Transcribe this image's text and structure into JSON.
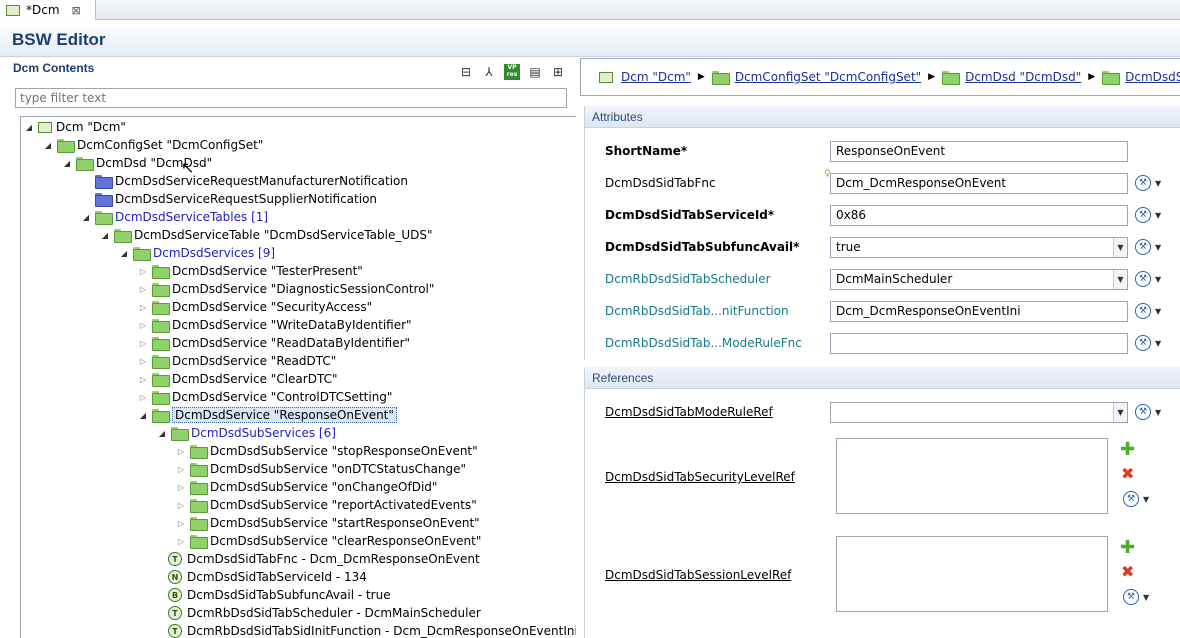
{
  "tab": {
    "title": "*Dcm"
  },
  "editor": {
    "title": "BSW Editor"
  },
  "left": {
    "title": "Dcm Contents",
    "filter_placeholder": "type filter text"
  },
  "tree": [
    {
      "label": "Dcm \"Dcm\"",
      "indent": 0,
      "twisty": "open",
      "icon": "dcm"
    },
    {
      "label": "DcmConfigSet \"DcmConfigSet\"",
      "indent": 1,
      "twisty": "open",
      "icon": "green"
    },
    {
      "label": "DcmDsd \"DcmDsd\"",
      "indent": 2,
      "twisty": "open",
      "icon": "green"
    },
    {
      "label": "DcmDsdServiceRequestManufacturerNotification",
      "indent": 3,
      "twisty": "none",
      "icon": "blue"
    },
    {
      "label": "DcmDsdServiceRequestSupplierNotification",
      "indent": 3,
      "twisty": "none",
      "icon": "blue"
    },
    {
      "label": "DcmDsdServiceTables [1]",
      "indent": 3,
      "twisty": "open",
      "icon": "green",
      "style": "blue"
    },
    {
      "label": "DcmDsdServiceTable \"DcmDsdServiceTable_UDS\"",
      "indent": 4,
      "twisty": "open",
      "icon": "green"
    },
    {
      "label": "DcmDsdServices [9]",
      "indent": 5,
      "twisty": "open",
      "icon": "green",
      "style": "blue"
    },
    {
      "label": "DcmDsdService \"TesterPresent\"",
      "indent": 6,
      "twisty": "closed",
      "icon": "green"
    },
    {
      "label": "DcmDsdService \"DiagnosticSessionControl\"",
      "indent": 6,
      "twisty": "closed",
      "icon": "green"
    },
    {
      "label": "DcmDsdService \"SecurityAccess\"",
      "indent": 6,
      "twisty": "closed",
      "icon": "green"
    },
    {
      "label": "DcmDsdService \"WriteDataByIdentifier\"",
      "indent": 6,
      "twisty": "closed",
      "icon": "green"
    },
    {
      "label": "DcmDsdService \"ReadDataByIdentifier\"",
      "indent": 6,
      "twisty": "closed",
      "icon": "green"
    },
    {
      "label": "DcmDsdService \"ReadDTC\"",
      "indent": 6,
      "twisty": "closed",
      "icon": "green"
    },
    {
      "label": "DcmDsdService \"ClearDTC\"",
      "indent": 6,
      "twisty": "closed",
      "icon": "green"
    },
    {
      "label": "DcmDsdService \"ControlDTCSetting\"",
      "indent": 6,
      "twisty": "closed",
      "icon": "green"
    },
    {
      "label": "DcmDsdService \"ResponseOnEvent\"",
      "indent": 6,
      "twisty": "open",
      "icon": "green",
      "style": "sel"
    },
    {
      "label": "DcmDsdSubServices [6]",
      "indent": 7,
      "twisty": "open",
      "icon": "green",
      "style": "blue"
    },
    {
      "label": "DcmDsdSubService \"stopResponseOnEvent\"",
      "indent": 8,
      "twisty": "closed",
      "icon": "green"
    },
    {
      "label": "DcmDsdSubService \"onDTCStatusChange\"",
      "indent": 8,
      "twisty": "closed",
      "icon": "green"
    },
    {
      "label": "DcmDsdSubService \"onChangeOfDid\"",
      "indent": 8,
      "twisty": "closed",
      "icon": "green"
    },
    {
      "label": "DcmDsdSubService \"reportActivatedEvents\"",
      "indent": 8,
      "twisty": "closed",
      "icon": "green"
    },
    {
      "label": "DcmDsdSubService \"startResponseOnEvent\"",
      "indent": 8,
      "twisty": "closed",
      "icon": "green"
    },
    {
      "label": "DcmDsdSubService \"clearResponseOnEvent\"",
      "indent": 8,
      "twisty": "closed",
      "icon": "green"
    },
    {
      "label": "DcmDsdSidTabFnc - Dcm_DcmResponseOnEvent",
      "indent": 7,
      "twisty": "none",
      "icon": "T"
    },
    {
      "label": "DcmDsdSidTabServiceId - 134",
      "indent": 7,
      "twisty": "none",
      "icon": "N"
    },
    {
      "label": "DcmDsdSidTabSubfuncAvail - true",
      "indent": 7,
      "twisty": "none",
      "icon": "B"
    },
    {
      "label": "DcmRbDsdSidTabScheduler - DcmMainScheduler",
      "indent": 7,
      "twisty": "none",
      "icon": "T"
    },
    {
      "label": "DcmRbDsdSidTabSidInitFunction - Dcm_DcmResponseOnEventIni",
      "indent": 7,
      "twisty": "none",
      "icon": "T"
    }
  ],
  "breadcrumb": [
    "Dcm \"Dcm\"",
    "DcmConfigSet \"DcmConfigSet\"",
    "DcmDsd \"DcmDsd\"",
    "DcmDsdServiceTables"
  ],
  "attributes": {
    "title": "Attributes",
    "rows": [
      {
        "label": "ShortName*",
        "value": "ResponseOnEvent",
        "style": "bold",
        "kind": "text",
        "tool": false
      },
      {
        "label": "DcmDsdSidTabFnc",
        "value": "Dcm_DcmResponseOnEvent",
        "style": "normal",
        "kind": "text",
        "tool": true,
        "warn": true
      },
      {
        "label": "DcmDsdSidTabServiceId*",
        "value": "0x86",
        "style": "bold",
        "kind": "text",
        "tool": true
      },
      {
        "label": "DcmDsdSidTabSubfuncAvail*",
        "value": "true",
        "style": "bold",
        "kind": "combo",
        "tool": true
      },
      {
        "label": "DcmRbDsdSidTabScheduler",
        "value": "DcmMainScheduler",
        "style": "teal",
        "kind": "combo",
        "tool": true
      },
      {
        "label": "DcmRbDsdSidTab...nitFunction",
        "value": "Dcm_DcmResponseOnEventIni",
        "style": "teal",
        "kind": "text",
        "tool": true
      },
      {
        "label": "DcmRbDsdSidTab...ModeRuleFnc",
        "value": "",
        "style": "teal",
        "kind": "text",
        "tool": true
      }
    ]
  },
  "references": {
    "title": "References",
    "mode_rule": {
      "label": "DcmDsdSidTabModeRuleRef",
      "value": ""
    },
    "security": {
      "label": "DcmDsdSidTabSecurityLevelRef"
    },
    "session": {
      "label": "DcmDsdSidTabSessionLevelRef"
    }
  }
}
